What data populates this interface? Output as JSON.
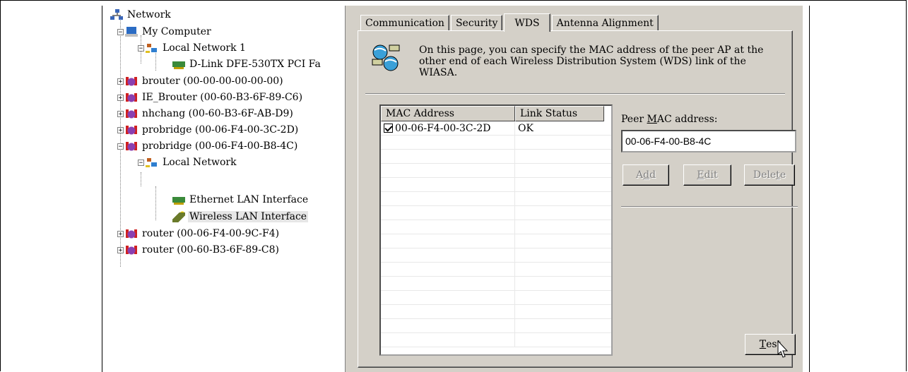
{
  "tree": {
    "items": [
      {
        "label": "Network",
        "icon": "network-icon"
      },
      {
        "label": "My Computer",
        "icon": "computer-icon"
      },
      {
        "label": "Local Network 1",
        "icon": "local-network-icon"
      },
      {
        "label": "D-Link DFE-530TX PCI Fa",
        "icon": "network-card-icon"
      },
      {
        "label": "brouter (00-00-00-00-00-00)",
        "icon": "router-icon"
      },
      {
        "label": "IE_Brouter (00-60-B3-6F-89-C6)",
        "icon": "router-icon"
      },
      {
        "label": "nhchang (00-60-B3-6F-AB-D9)",
        "icon": "router-icon"
      },
      {
        "label": "probridge (00-06-F4-00-3C-2D)",
        "icon": "router-icon"
      },
      {
        "label": "probridge (00-06-F4-00-B8-4C)",
        "icon": "router-icon"
      },
      {
        "label": "Local Network",
        "icon": "local-network-icon"
      },
      {
        "label": "Ethernet LAN Interface",
        "icon": "network-card-icon"
      },
      {
        "label": "Wireless LAN Interface",
        "icon": "wireless-card-icon"
      },
      {
        "label": "router (00-06-F4-00-9C-F4)",
        "icon": "router-icon"
      },
      {
        "label": "router (00-60-B3-6F-89-C8)",
        "icon": "router-icon"
      }
    ]
  },
  "tabs": [
    "Communication",
    "Security",
    "WDS",
    "Antenna Alignment"
  ],
  "active_tab": "WDS",
  "wds": {
    "info_line1": "On this page, you can specify the MAC address of the peer AP at the",
    "info_line2": "other end of each Wireless Distribution System (WDS) link of the",
    "info_line3": "WIASA.",
    "columns": [
      "MAC Address",
      "Link Status"
    ],
    "rows": [
      {
        "checked": true,
        "mac": "00-06-F4-00-3C-2D",
        "status": "OK"
      }
    ],
    "peer_label_pre": "Peer ",
    "peer_label_ul": "M",
    "peer_label_post": "AC address:",
    "peer_value": "00-06-F4-00-B8-4C",
    "add_pre": "A",
    "add_ul": "d",
    "add_post": "d",
    "edit_ul": "E",
    "edit_post": "dit",
    "delete_pre": "Dele",
    "delete_ul": "t",
    "delete_post": "e",
    "test_ul": "T",
    "test_post": "est"
  }
}
